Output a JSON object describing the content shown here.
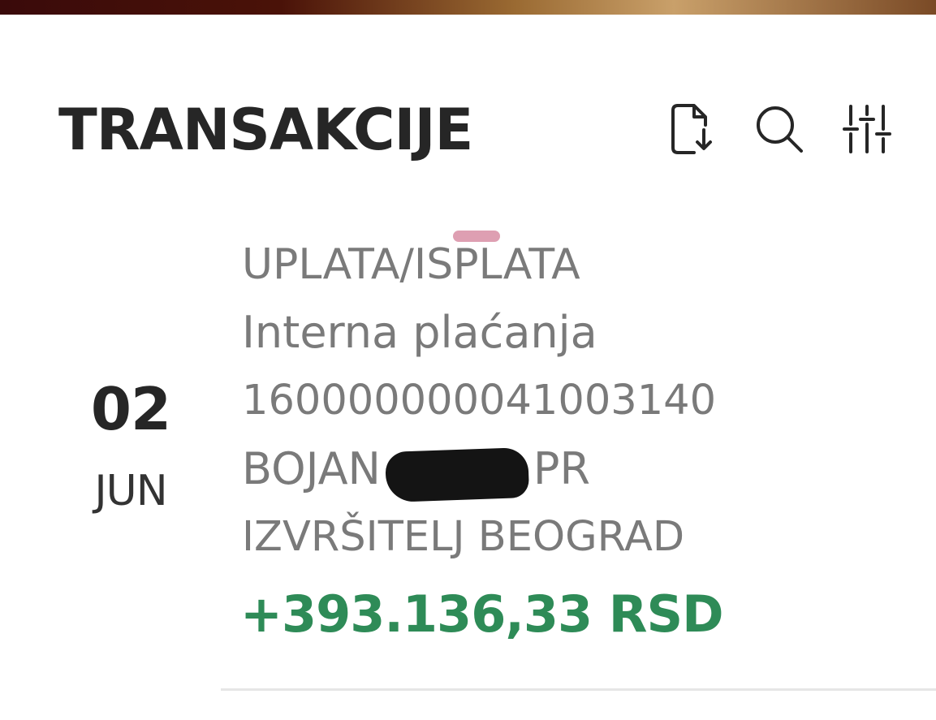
{
  "header": {
    "title": "TRANSAKCIJE",
    "icons": [
      "document-download-icon",
      "search-icon",
      "filter-sliders-icon"
    ]
  },
  "transaction": {
    "day": "02",
    "month": "JUN",
    "type": "UPLATA/ISPLATA",
    "category": "Interna plaćanja",
    "account": "160000000041003140",
    "party_first": "BOJAN",
    "party_last": "PR",
    "party_line2": "IZVRŠITELJ BEOGRAD",
    "amount": "+393.136,33 RSD"
  },
  "colors": {
    "text_dark": "#262626",
    "text_gray": "#7a7a7a",
    "amount_positive": "#2e8b57"
  }
}
